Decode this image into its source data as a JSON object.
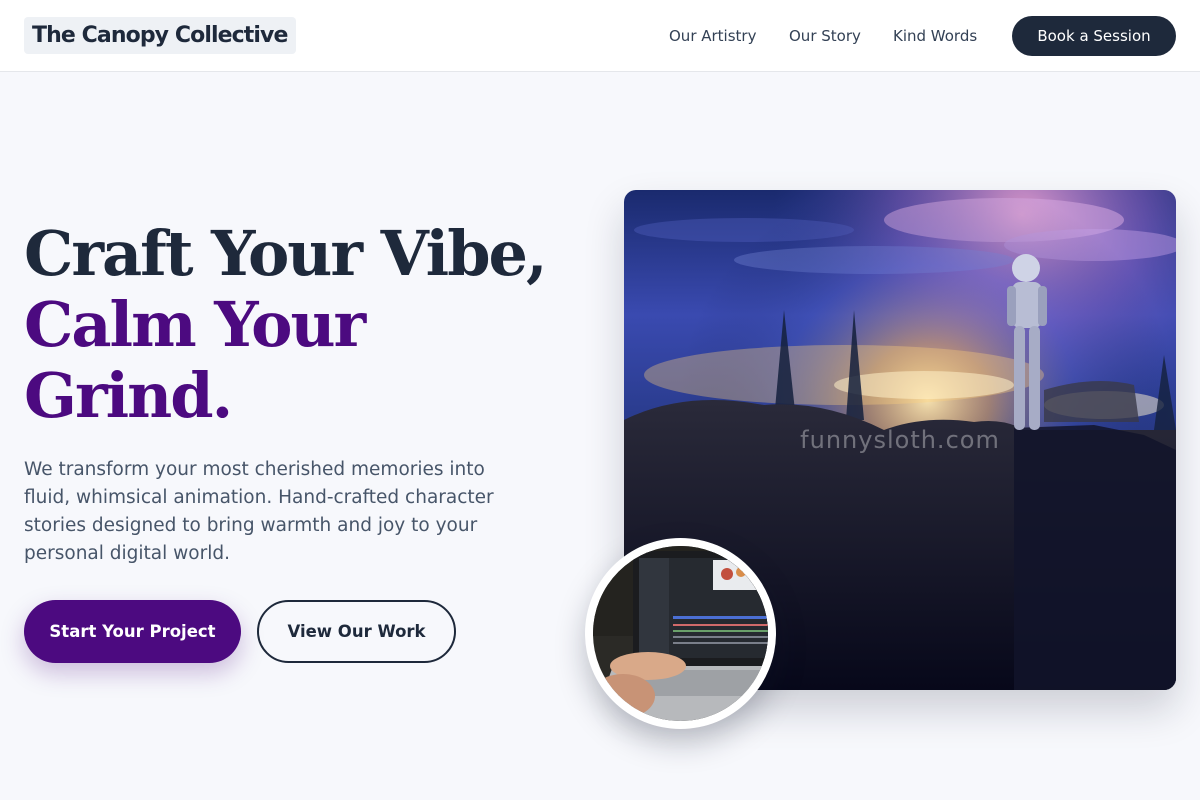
{
  "header": {
    "logo": "The Canopy Collective",
    "nav": {
      "artistry": "Our Artistry",
      "story": "Our Story",
      "kind_words": "Kind Words"
    },
    "cta": "Book a Session"
  },
  "hero": {
    "title_line1": "Craft Your Vibe,",
    "title_line2": "Calm Your",
    "title_line3": "Grind.",
    "description": "We transform your most cherished memories into fluid, whimsical animation. Hand-crafted character stories designed to bring warmth and joy to your personal digital world.",
    "primary_button": "Start Your Project",
    "secondary_button": "View Our Work",
    "image_watermark": "funnysloth.com"
  },
  "colors": {
    "brand_dark": "#1e293b",
    "brand_purple": "#4c0a80",
    "page_background": "#f7f8fc"
  },
  "icons": {
    "hero_image": "astronaut-on-cliff-night-city-image",
    "inset_image": "laptop-animation-editing-image"
  }
}
